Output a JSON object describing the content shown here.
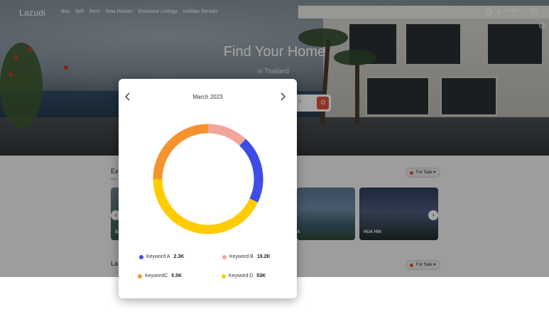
{
  "nav": {
    "logo": "Lazudi",
    "links": [
      "Buy",
      "Sell",
      "Rent",
      "New Homes",
      "Exclusive Listings",
      "Holiday Rentals"
    ],
    "lang_prefix": "฿",
    "lang": "TH-EN",
    "icons": [
      "globe-icon",
      "menu-icon"
    ]
  },
  "hero": {
    "title": "Find Your Home",
    "subtitle": "in Thailand",
    "search_hint": "D",
    "search_icon": "search-icon"
  },
  "sections": {
    "explore": {
      "title_visible": "Ex",
      "sub_visible": "Sea",
      "filter": "For Sale",
      "cards": [
        {
          "label": "BA"
        },
        {
          "label": "A"
        },
        {
          "label": "HUA HIN"
        }
      ]
    },
    "latest": {
      "title_visible": "La",
      "filter": "For Sale"
    }
  },
  "modal": {
    "month": "March 2023",
    "prev_icon": "chevron-left-icon",
    "next_icon": "chevron-right-icon",
    "legend": [
      {
        "label": "Keyword A",
        "value": "2.3K",
        "color": "#3d4de6"
      },
      {
        "label": "Keyword B",
        "value": "19.2K",
        "color": "#f2a59b"
      },
      {
        "label": "KeywordC",
        "value": "5.5K",
        "color": "#f5922e"
      },
      {
        "label": "Keyword D",
        "value": "53K",
        "color": "#ffcc00"
      }
    ]
  },
  "chart_data": {
    "type": "pie",
    "style": "donut",
    "title": "March 2023",
    "categories": [
      "Keyword B",
      "Keyword A",
      "Keyword D",
      "KeywordC"
    ],
    "values": [
      12,
      20,
      43,
      25
    ],
    "unit": "%",
    "colors": [
      "#f2a59b",
      "#3d4de6",
      "#ffcc00",
      "#f5922e"
    ]
  }
}
